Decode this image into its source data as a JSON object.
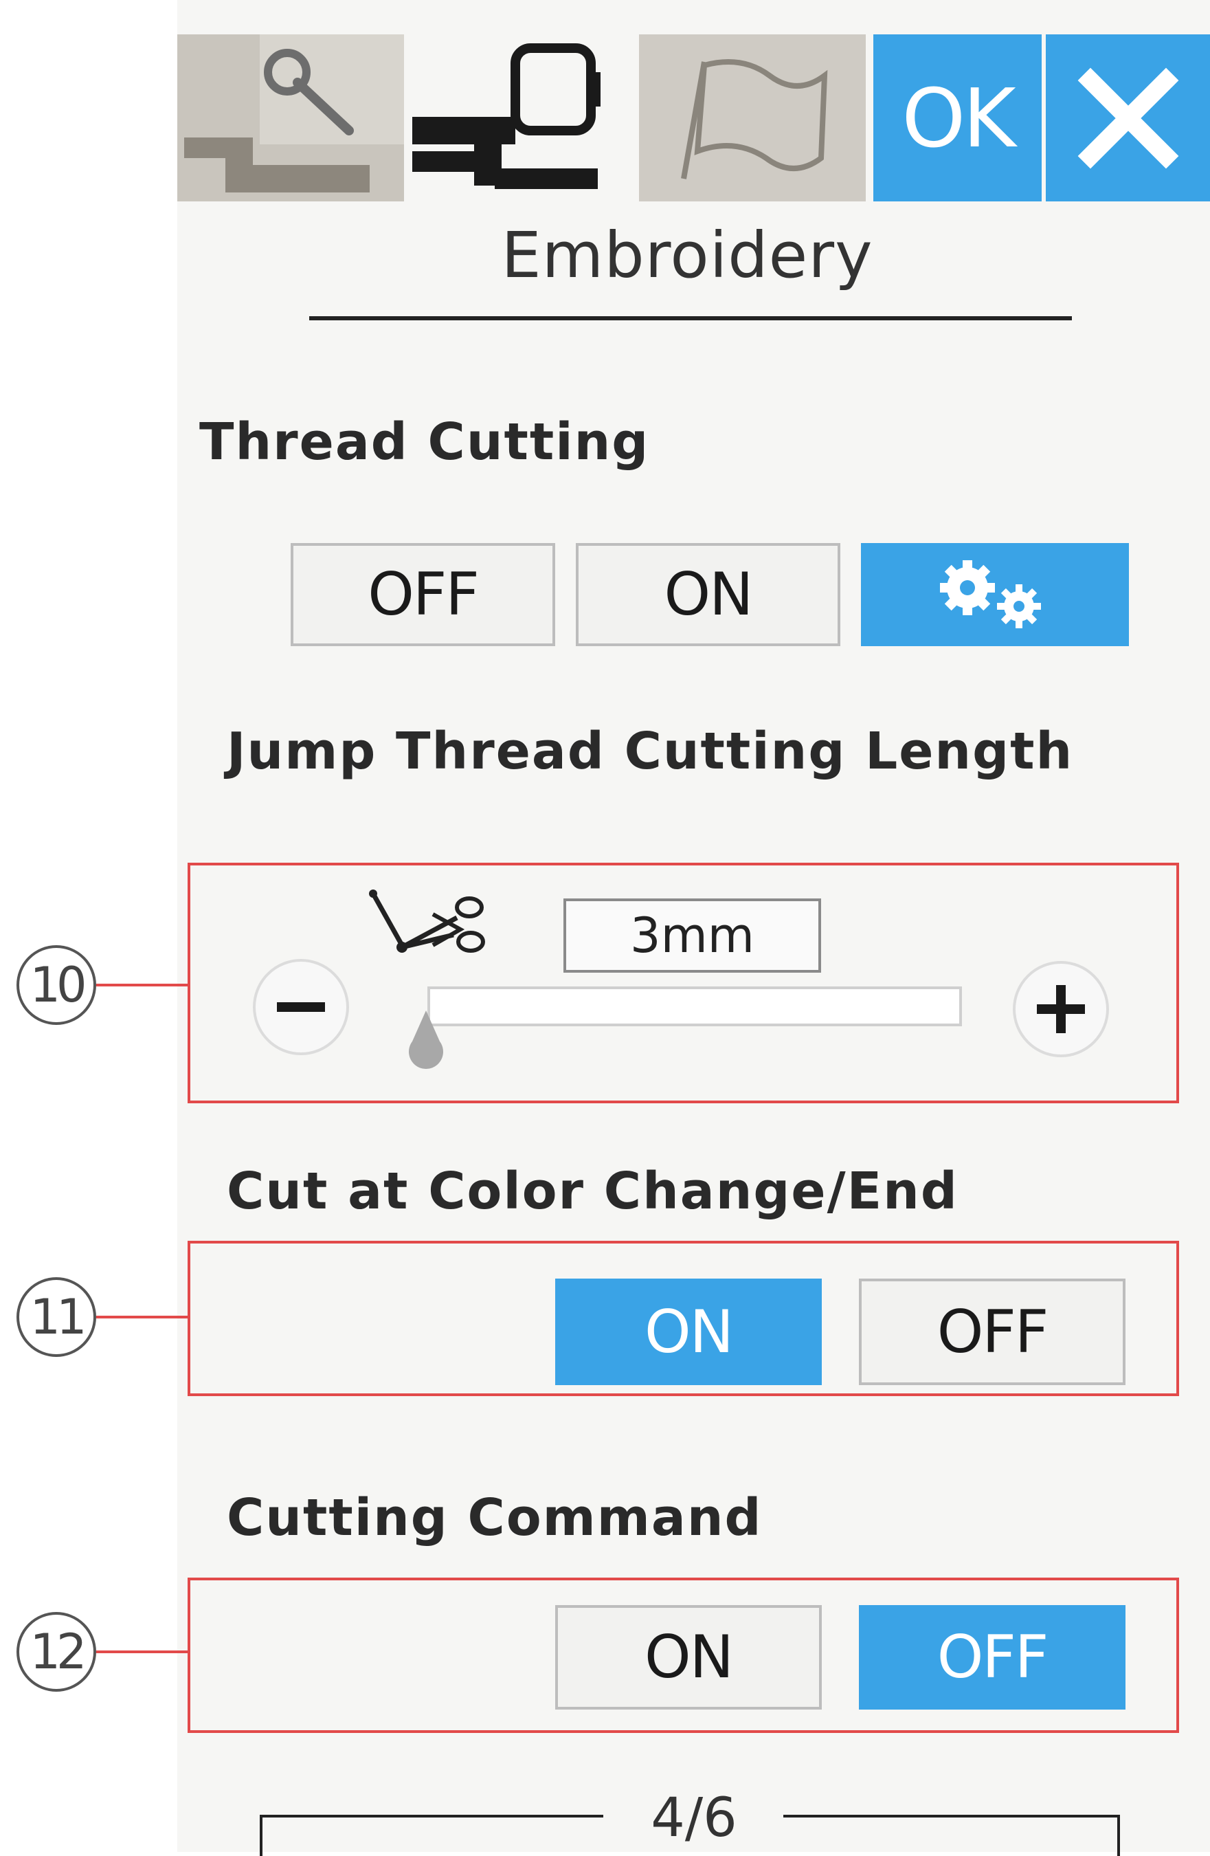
{
  "toolbar": {
    "tabs": [
      {
        "name": "common-settings",
        "icon": "wrench-machine-icon",
        "active": false
      },
      {
        "name": "embroidery-settings",
        "icon": "embroidery-machine-icon",
        "active": true
      },
      {
        "name": "language",
        "icon": "flag-icon",
        "active": false
      }
    ],
    "ok_label": "OK",
    "close_icon": "close-icon"
  },
  "title": "Embroidery",
  "thread_cutting": {
    "label": "Thread Cutting",
    "options": [
      "OFF",
      "ON"
    ],
    "settings_icon": "gears-icon",
    "selected": "settings"
  },
  "jump_thread": {
    "label": "Jump Thread Cutting Length",
    "value": "3mm",
    "slider_level": 0,
    "icon": "jump-stitch-scissors-icon"
  },
  "cut_color_change": {
    "label": "Cut at Color Change/End",
    "on_label": "ON",
    "off_label": "OFF",
    "selected": "ON"
  },
  "cutting_command": {
    "label": "Cutting Command",
    "on_label": "ON",
    "off_label": "OFF",
    "selected": "OFF"
  },
  "callouts": [
    "10",
    "11",
    "12"
  ],
  "pager": "4/6",
  "colors": {
    "accent": "#3aa3e6",
    "callout": "#e24a4a"
  }
}
